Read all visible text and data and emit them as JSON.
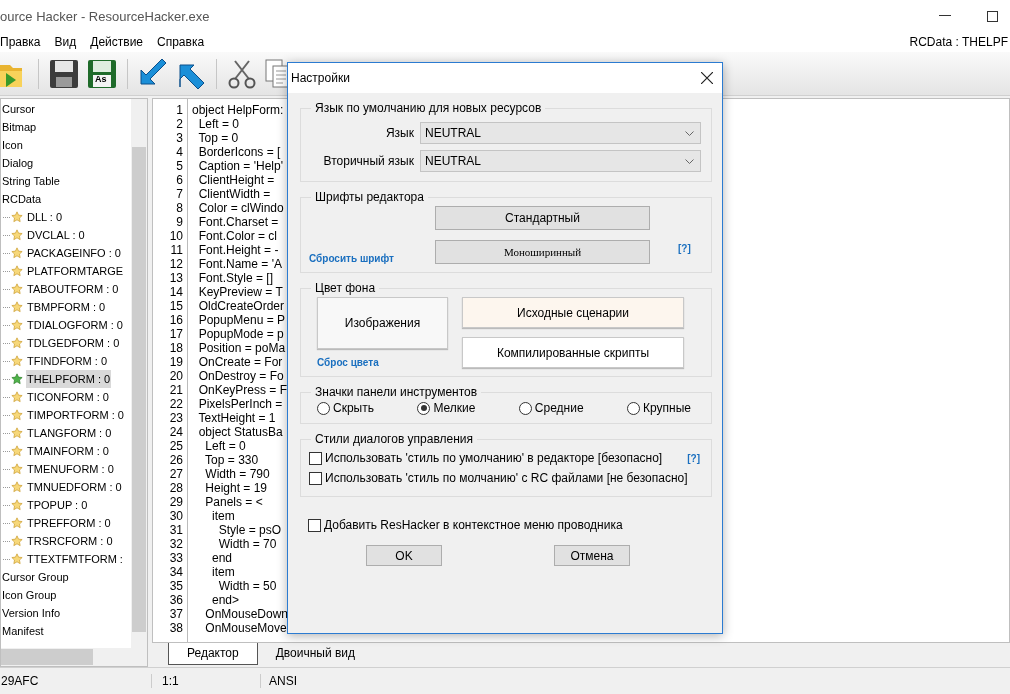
{
  "window": {
    "title": "ource Hacker - ResourceHacker.exe"
  },
  "menu": [
    "Правка",
    "Вид",
    "Действие",
    "Справка"
  ],
  "breadcrumb": "RCData : THELPF",
  "toolbar": [
    {
      "kind": "open"
    },
    {
      "kind": "save"
    },
    {
      "kind": "save_as",
      "label": "As"
    },
    {
      "kind": "back"
    },
    {
      "kind": "forward"
    },
    {
      "kind": "cut"
    },
    {
      "kind": "copy"
    }
  ],
  "tree": [
    {
      "label": "Cursor",
      "selected": false
    },
    {
      "label": "Bitmap",
      "selected": false
    },
    {
      "label": "Icon",
      "selected": false
    },
    {
      "label": "Dialog",
      "selected": false
    },
    {
      "label": "String Table",
      "selected": false
    },
    {
      "label": "RCData",
      "selected": false,
      "children": [
        {
          "label": "DLL : 0",
          "selected": false
        },
        {
          "label": "DVCLAL : 0",
          "selected": false
        },
        {
          "label": "PACKAGEINFO : 0",
          "selected": false
        },
        {
          "label": "PLATFORMTARGE",
          "selected": false
        },
        {
          "label": "TABOUTFORM : 0",
          "selected": false
        },
        {
          "label": "TBMPFORM : 0",
          "selected": false
        },
        {
          "label": "TDIALOGFORM : 0",
          "selected": false
        },
        {
          "label": "TDLGEDFORM : 0",
          "selected": false
        },
        {
          "label": "TFINDFORM : 0",
          "selected": false
        },
        {
          "label": "THELPFORM : 0",
          "selected": true
        },
        {
          "label": "TICONFORM : 0",
          "selected": false
        },
        {
          "label": "TIMPORTFORM : 0",
          "selected": false
        },
        {
          "label": "TLANGFORM : 0",
          "selected": false
        },
        {
          "label": "TMAINFORM : 0",
          "selected": false
        },
        {
          "label": "TMENUFORM : 0",
          "selected": false
        },
        {
          "label": "TMNUEDFORM : 0",
          "selected": false
        },
        {
          "label": "TPOPUP : 0",
          "selected": false
        },
        {
          "label": "TPREFFORM : 0",
          "selected": false
        },
        {
          "label": "TRSRCFORM : 0",
          "selected": false
        },
        {
          "label": "TTEXTFMTFORM :",
          "selected": false
        }
      ]
    },
    {
      "label": "Cursor Group",
      "selected": false
    },
    {
      "label": "Icon Group",
      "selected": false
    },
    {
      "label": "Version Info",
      "selected": false
    },
    {
      "label": "Manifest",
      "selected": false
    }
  ],
  "editor": {
    "lines": [
      {
        "number": "1",
        "text": "object HelpForm:"
      },
      {
        "number": "2",
        "text": "  Left = 0"
      },
      {
        "number": "3",
        "text": "  Top = 0"
      },
      {
        "number": "4",
        "text": "  BorderIcons = ["
      },
      {
        "number": "5",
        "text": "  Caption = 'Help'"
      },
      {
        "number": "6",
        "text": "  ClientHeight ="
      },
      {
        "number": "7",
        "text": "  ClientWidth ="
      },
      {
        "number": "8",
        "text": "  Color = clWindo"
      },
      {
        "number": "9",
        "text": "  Font.Charset ="
      },
      {
        "number": "10",
        "text": "  Font.Color = cl"
      },
      {
        "number": "11",
        "text": "  Font.Height = -"
      },
      {
        "number": "12",
        "text": "  Font.Name = 'A"
      },
      {
        "number": "13",
        "text": "  Font.Style = []"
      },
      {
        "number": "14",
        "text": "  KeyPreview = T"
      },
      {
        "number": "15",
        "text": "  OldCreateOrder"
      },
      {
        "number": "16",
        "text": "  PopupMenu = P"
      },
      {
        "number": "17",
        "text": "  PopupMode = p"
      },
      {
        "number": "18",
        "text": "  Position = poMa"
      },
      {
        "number": "19",
        "text": "  OnCreate = For"
      },
      {
        "number": "20",
        "text": "  OnDestroy = Fo"
      },
      {
        "number": "21",
        "text": "  OnKeyPress = F"
      },
      {
        "number": "22",
        "text": "  PixelsPerInch ="
      },
      {
        "number": "23",
        "text": "  TextHeight = 1"
      },
      {
        "number": "24",
        "text": "  object StatusBa"
      },
      {
        "number": "25",
        "text": "    Left = 0"
      },
      {
        "number": "26",
        "text": "    Top = 330"
      },
      {
        "number": "27",
        "text": "    Width = 790"
      },
      {
        "number": "28",
        "text": "    Height = 19"
      },
      {
        "number": "29",
        "text": "    Panels = <"
      },
      {
        "number": "30",
        "text": "      item"
      },
      {
        "number": "31",
        "text": "        Style = psO"
      },
      {
        "number": "32",
        "text": "        Width = 70"
      },
      {
        "number": "33",
        "text": "      end"
      },
      {
        "number": "34",
        "text": "      item"
      },
      {
        "number": "35",
        "text": "        Width = 50"
      },
      {
        "number": "36",
        "text": "      end>"
      },
      {
        "number": "37",
        "text": "    OnMouseDown"
      },
      {
        "number": "38",
        "text": "    OnMouseMove"
      }
    ]
  },
  "editor_tabs": [
    {
      "label": "Редактор",
      "selected": true
    },
    {
      "label": "Двоичный вид",
      "selected": false
    }
  ],
  "status_bar": [
    "29AFC",
    "1:1",
    "ANSI"
  ],
  "dialog": {
    "title": "Настройки",
    "language_group": {
      "title": "Язык по умолчанию для новых ресурсов",
      "fields": [
        {
          "label": "Язык",
          "value": "NEUTRAL"
        },
        {
          "label": "Вторичный язык",
          "value": "NEUTRAL"
        }
      ]
    },
    "fonts_group": {
      "title": "Шрифты редактора",
      "buttons": [
        "Стандартный",
        "Моноширинный"
      ],
      "reset_link": "Сбросить шрифт",
      "help_link": "[?]"
    },
    "background_group": {
      "title": "Цвет фона",
      "buttons": [
        {
          "label": "Изображения",
          "color": "#f8f8f8"
        },
        {
          "label": "Исходные сценарии",
          "color": "#fdf6ee"
        },
        {
          "label": "Компилированные скрипты",
          "color": "#ffffff"
        }
      ],
      "reset_link": "Сброс цвета"
    },
    "toolbar_icons_group": {
      "title": "Значки панели инструментов",
      "options": [
        {
          "label": "Скрыть",
          "selected": false
        },
        {
          "label": "Мелкие",
          "selected": true
        },
        {
          "label": "Средние",
          "selected": false
        },
        {
          "label": "Крупные",
          "selected": false
        }
      ]
    },
    "styles_group": {
      "title": "Стили диалогов управления",
      "options": [
        {
          "label": "Использовать 'стиль по умолчанию' в редакторе [безопасно]",
          "checked": false
        },
        {
          "label": "Использовать 'стиль по молчанию' с RC файлами [не безопасно]",
          "checked": false
        }
      ],
      "help_link": "[?]"
    },
    "context_menu_option": {
      "label": "Добавить ResHacker в контекстное меню проводника",
      "checked": false
    },
    "buttons": [
      "OK",
      "Отмена"
    ]
  }
}
